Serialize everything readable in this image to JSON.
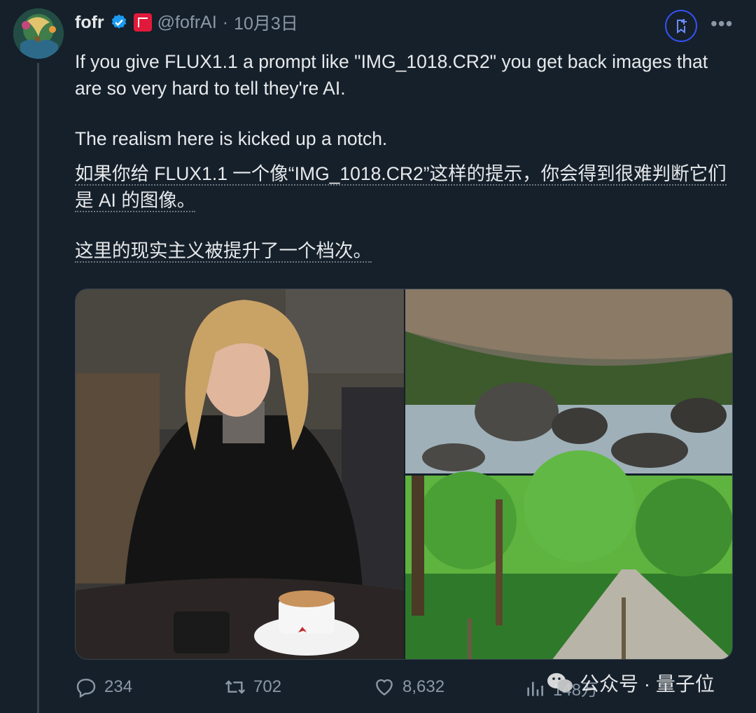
{
  "author": {
    "name": "fofr",
    "handle": "@fofrAI",
    "separator": "·",
    "date": "10月3日"
  },
  "tweet": {
    "line1": "If you give FLUX1.1 a prompt like \"IMG_1018.CR2\" you get back images that",
    "line2": "are so very hard to tell they're AI.",
    "line3": "The realism here is kicked up a notch.",
    "tr_line1": "如果你给 FLUX1.1 一个像“IMG_1018.CR2”这样的提示，你会得到很难判断它们",
    "tr_line2": "是 AI 的图像。",
    "tr_line3": "这里的现实主义被提升了一个档次。"
  },
  "media": {
    "images": [
      {
        "subject": "woman-in-cafe"
      },
      {
        "subject": "mountain-stream"
      },
      {
        "subject": "forest-path"
      }
    ]
  },
  "actions": {
    "replies": "234",
    "reposts": "702",
    "likes": "8,632",
    "views": "148万"
  },
  "watermark": {
    "text": "公众号 · 量子位"
  },
  "colors": {
    "background": "#15202b",
    "text": "#e7e9ea",
    "muted": "#8b98a5",
    "verified": "#1d9bf0",
    "grok_ring": "#3552f0"
  }
}
